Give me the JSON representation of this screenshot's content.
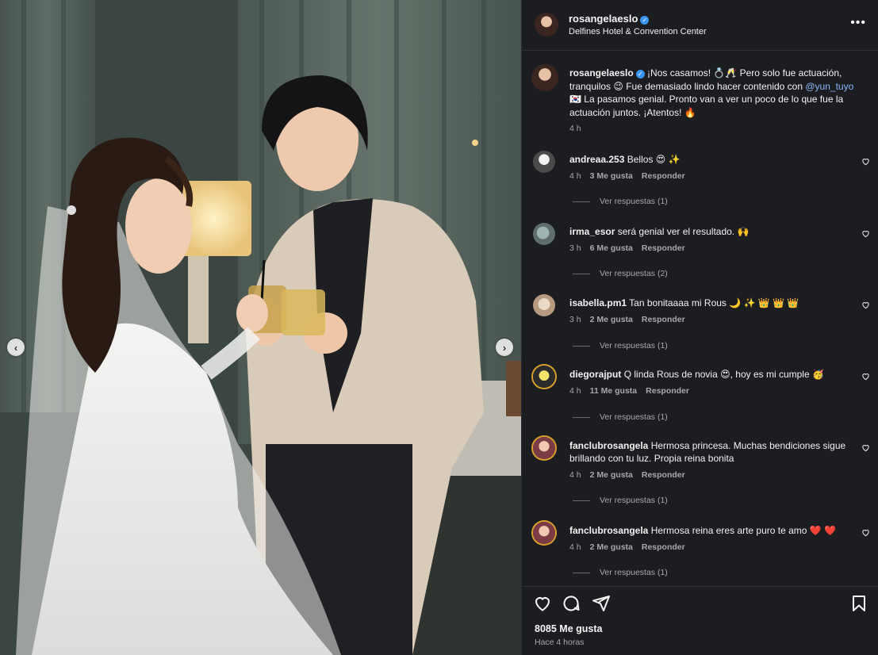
{
  "post": {
    "username": "rosangelaeslo",
    "verified": true,
    "location": "Delfines Hotel & Convention Center",
    "more_icon": "more-horizontal-icon"
  },
  "photo": {
    "prev_icon": "chevron-left-icon",
    "next_icon": "chevron-right-icon",
    "prev_glyph": "‹",
    "next_glyph": "›"
  },
  "caption": {
    "username": "rosangelaeslo",
    "text_before_mention": "¡Nos casamos! 💍🥂 Pero solo fue actuación, tranquilos 😉 Fue demasiado lindo hacer contenido con ",
    "mention": "@yun_tuyo",
    "text_after_mention": " 🇰🇷 La pasamos genial. Pronto van a ver un poco de lo que fue la actuación juntos. ¡Atentos! 🔥",
    "time": "4 h"
  },
  "comments": [
    {
      "username": "andreaa.253",
      "text": "Bellos 😍 ✨",
      "time": "4 h",
      "likes": "3 Me gusta",
      "reply": "Responder",
      "view_replies": "Ver respuestas (1)"
    },
    {
      "username": "irma_esor",
      "text": "será genial ver el resultado. 🙌",
      "time": "3 h",
      "likes": "6 Me gusta",
      "reply": "Responder",
      "view_replies": "Ver respuestas (2)"
    },
    {
      "username": "isabella.pm1",
      "text": "Tan bonitaaaa mi Rous 🌙 ✨ 👑 👑 👑",
      "time": "3 h",
      "likes": "2 Me gusta",
      "reply": "Responder",
      "view_replies": "Ver respuestas (1)"
    },
    {
      "username": "diegorajput",
      "text": "Q linda Rous de novia 😍, hoy es mi cumple 🥳",
      "time": "4 h",
      "likes": "11 Me gusta",
      "reply": "Responder",
      "view_replies": "Ver respuestas (1)"
    },
    {
      "username": "fanclubrosangela",
      "text": "Hermosa princesa. Muchas bendiciones sigue brillando con tu luz. Propia reina bonita",
      "time": "4 h",
      "likes": "2 Me gusta",
      "reply": "Responder",
      "view_replies": "Ver respuestas (1)"
    },
    {
      "username": "fanclubrosangela",
      "text": "Hermosa reina eres arte puro te amo ❤️ ❤️",
      "time": "4 h",
      "likes": "2 Me gusta",
      "reply": "Responder",
      "view_replies": "Ver respuestas (1)"
    }
  ],
  "actions": {
    "like_icon": "heart-icon",
    "comment_icon": "comment-icon",
    "share_icon": "share-icon",
    "save_icon": "bookmark-icon",
    "likes_count": "8085 Me gusta",
    "posted_ago": "Hace 4 horas"
  },
  "colors": {
    "panel_bg": "#1c1d21",
    "text": "#f5f5f5",
    "muted": "#a8a8a8",
    "verified": "#3797f0",
    "mention": "#8ab4f8"
  }
}
